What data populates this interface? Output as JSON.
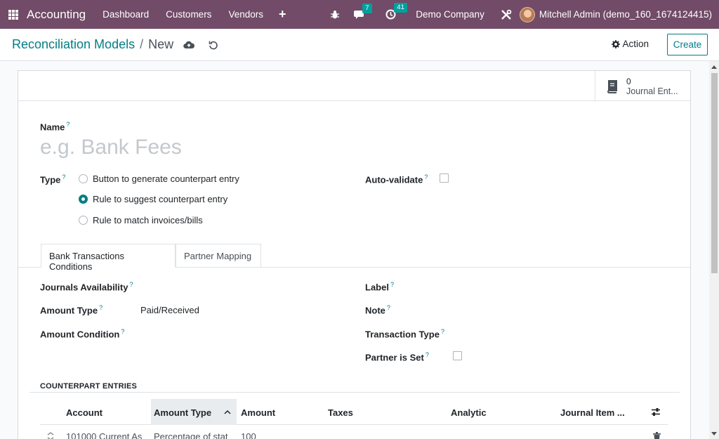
{
  "navbar": {
    "app_name": "Accounting",
    "menu": [
      "Dashboard",
      "Customers",
      "Vendors"
    ],
    "plus_label": "+",
    "messages_count": "7",
    "activities_count": "41",
    "company": "Demo Company",
    "user": "Mitchell Admin (demo_160_1674124415)"
  },
  "breadcrumb": {
    "parent": "Reconciliation Models",
    "separator": "/",
    "current": "New"
  },
  "control": {
    "action_label": "Action",
    "create_label": "Create"
  },
  "stat_button": {
    "count": "0",
    "label": "Journal Ent..."
  },
  "form": {
    "name_label": "Name",
    "name_placeholder": "e.g. Bank Fees",
    "type_label": "Type",
    "type_options": [
      {
        "label": "Button to generate counterpart entry",
        "checked": false
      },
      {
        "label": "Rule to suggest counterpart entry",
        "checked": true
      },
      {
        "label": "Rule to match invoices/bills",
        "checked": false
      }
    ],
    "auto_validate_label": "Auto-validate",
    "help_mark": "?"
  },
  "tabs": [
    "Bank Transactions Conditions",
    "Partner Mapping"
  ],
  "conditions": {
    "journals_label": "Journals Availability",
    "amount_type_label": "Amount Type",
    "amount_type_value": "Paid/Received",
    "amount_condition_label": "Amount Condition",
    "label_label": "Label",
    "note_label": "Note",
    "transaction_type_label": "Transaction Type",
    "partner_set_label": "Partner is Set"
  },
  "counterpart": {
    "title": "COUNTERPART ENTRIES",
    "columns": [
      "Account",
      "Amount Type",
      "Amount",
      "Taxes",
      "Analytic",
      "Journal Item ..."
    ],
    "rows": [
      {
        "account": "101000 Current As",
        "amount_type": "Percentage of stat",
        "amount": "100"
      }
    ]
  }
}
